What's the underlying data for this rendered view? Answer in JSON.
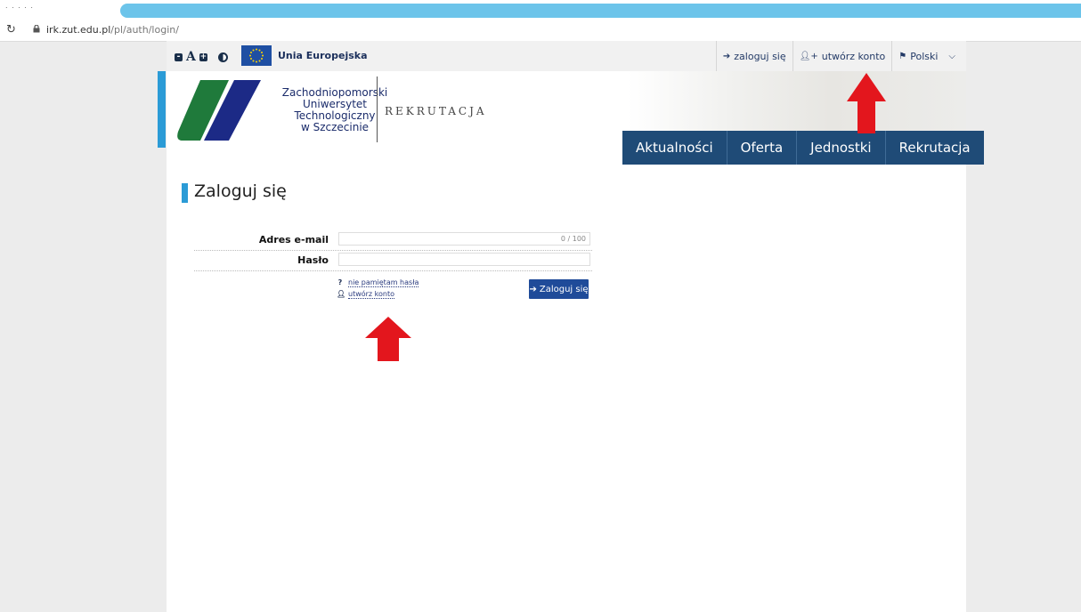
{
  "browser": {
    "tab_stub": ". . .   . .",
    "url_host": "irk.zut.edu.pl",
    "url_path": "/pl/auth/login/"
  },
  "topbar": {
    "eu_label": "Unia Europejska",
    "login_link": "zaloguj się",
    "register_link": "utwórz konto",
    "language": "Polski",
    "font_a_label": "A",
    "font_minus": "-",
    "font_plus": "+"
  },
  "header": {
    "university_name": [
      "Zachodniopomorski",
      "Uniwersytet",
      "Technologiczny",
      "w Szczecinie"
    ],
    "section": "REKRUTACJA"
  },
  "main_nav": [
    "Aktualności",
    "Oferta",
    "Jednostki",
    "Rekrutacja"
  ],
  "page_title": "Zaloguj się",
  "form": {
    "email_label": "Adres e-mail",
    "email_value": "",
    "email_counter": "0 / 100",
    "password_label": "Hasło",
    "password_value": "",
    "forgot_password": "nie pamiętam hasła",
    "forgot_icon": "?",
    "create_account": "utwórz konto",
    "login_button": "Zaloguj się"
  },
  "colors": {
    "nav_bg": "#1f4b77",
    "accent": "#2b9bd6",
    "button": "#1f4b99",
    "arrow": "#e3161d"
  },
  "icons": [
    "lock-icon",
    "reload-icon",
    "login-icon",
    "user-plus-icon",
    "flag-icon",
    "chevron-down-icon",
    "contrast-icon"
  ]
}
